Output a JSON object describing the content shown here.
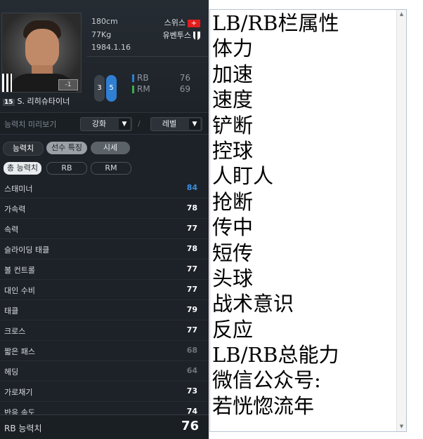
{
  "player": {
    "height": "180cm",
    "weight": "77Kg",
    "birth": "1984.1.16",
    "nation": "스위스",
    "nation_flag": "+",
    "club": "유벤투스",
    "number": "15",
    "name": "S. 리히슈타이너",
    "weak_foot_left": "3",
    "weak_foot_right": "5",
    "photo_chip": "-1"
  },
  "positions": [
    {
      "name": "RB",
      "value": "76",
      "color": "#2f7fd3"
    },
    {
      "name": "RM",
      "value": "69",
      "color": "#3fae49"
    }
  ],
  "preview": {
    "label": "능력치 미리보기",
    "dropdown1": "강화",
    "dropdown2": "레벨",
    "separator": "/"
  },
  "tabs": [
    "능력치",
    "선수 특징",
    "시세"
  ],
  "subtabs": [
    "총 능력치",
    "RB",
    "RM"
  ],
  "stats": [
    {
      "label": "스태미너",
      "value": "84",
      "color": "#3b8fe0"
    },
    {
      "label": "가속력",
      "value": "78",
      "color": "#ffffff"
    },
    {
      "label": "속력",
      "value": "77",
      "color": "#ffffff"
    },
    {
      "label": "슬라이딩 태클",
      "value": "78",
      "color": "#ffffff"
    },
    {
      "label": "볼 컨트롤",
      "value": "77",
      "color": "#ffffff"
    },
    {
      "label": "대인 수비",
      "value": "77",
      "color": "#ffffff"
    },
    {
      "label": "태클",
      "value": "79",
      "color": "#ffffff"
    },
    {
      "label": "크로스",
      "value": "77",
      "color": "#ffffff"
    },
    {
      "label": "짧은 패스",
      "value": "68",
      "color": "#6c747c"
    },
    {
      "label": "헤딩",
      "value": "64",
      "color": "#6c747c"
    },
    {
      "label": "가로채기",
      "value": "73",
      "color": "#ffffff"
    },
    {
      "label": "반응 속도",
      "value": "74",
      "color": "#ffffff"
    }
  ],
  "total": {
    "label": "RB 능력치",
    "value": "76"
  },
  "editor": {
    "lines": [
      "LB/RB栏属性",
      "体力",
      "加速",
      "速度",
      "铲断",
      "控球",
      "人盯人",
      "抢断",
      "传中",
      "短传",
      "头球",
      "战术意识",
      "反应",
      "LB/RB总能力",
      "微信公众号:",
      "若恍惚流年"
    ]
  }
}
